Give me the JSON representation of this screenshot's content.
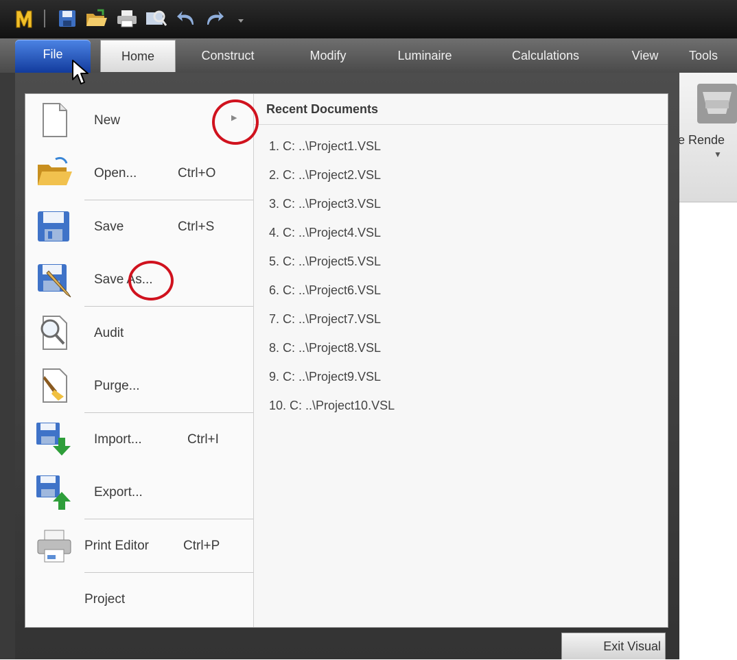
{
  "tabs": {
    "file": "File",
    "home": "Home",
    "construct": "Construct",
    "modify": "Modify",
    "luminaire": "Luminaire",
    "calculations": "Calculations",
    "view": "View",
    "tools": "Tools"
  },
  "ribbon": {
    "render_label": "e Rende"
  },
  "menu": {
    "new": {
      "label": "New"
    },
    "open": {
      "label": "Open...",
      "shortcut": "Ctrl+O"
    },
    "save": {
      "label": "Save",
      "shortcut": "Ctrl+S"
    },
    "save_as": {
      "label": "Save As..."
    },
    "audit": {
      "label": "Audit"
    },
    "purge": {
      "label": "Purge..."
    },
    "import": {
      "label": "Import...",
      "shortcut": "Ctrl+I"
    },
    "export": {
      "label": "Export..."
    },
    "print_editor": {
      "label": "Print Editor",
      "shortcut": "Ctrl+P"
    },
    "project": {
      "label": "Project"
    }
  },
  "recent": {
    "title": "Recent Documents",
    "items": [
      "1.  C: ..\\Project1.VSL",
      "2.  C: ..\\Project2.VSL",
      "3.  C: ..\\Project3.VSL",
      "4.  C: ..\\Project4.VSL",
      "5.  C: ..\\Project5.VSL",
      "6.  C: ..\\Project6.VSL",
      "7.  C: ..\\Project7.VSL",
      "8.  C: ..\\Project8.VSL",
      "9.  C: ..\\Project9.VSL",
      "10.  C: ..\\Project10.VSL"
    ]
  },
  "exit_button": "Exit Visual",
  "colors": {
    "annotation_ring": "#d0121e",
    "file_tab": "#1f4fb8"
  },
  "icons": [
    "app-logo-icon",
    "save-icon",
    "open-folder-icon",
    "print-icon",
    "print-preview-icon",
    "undo-icon",
    "redo-icon",
    "new-document-icon",
    "save-as-icon",
    "audit-icon",
    "purge-icon",
    "import-icon",
    "export-icon",
    "printer-icon",
    "submenu-arrow-icon",
    "render-icon",
    "mouse-cursor-icon"
  ]
}
